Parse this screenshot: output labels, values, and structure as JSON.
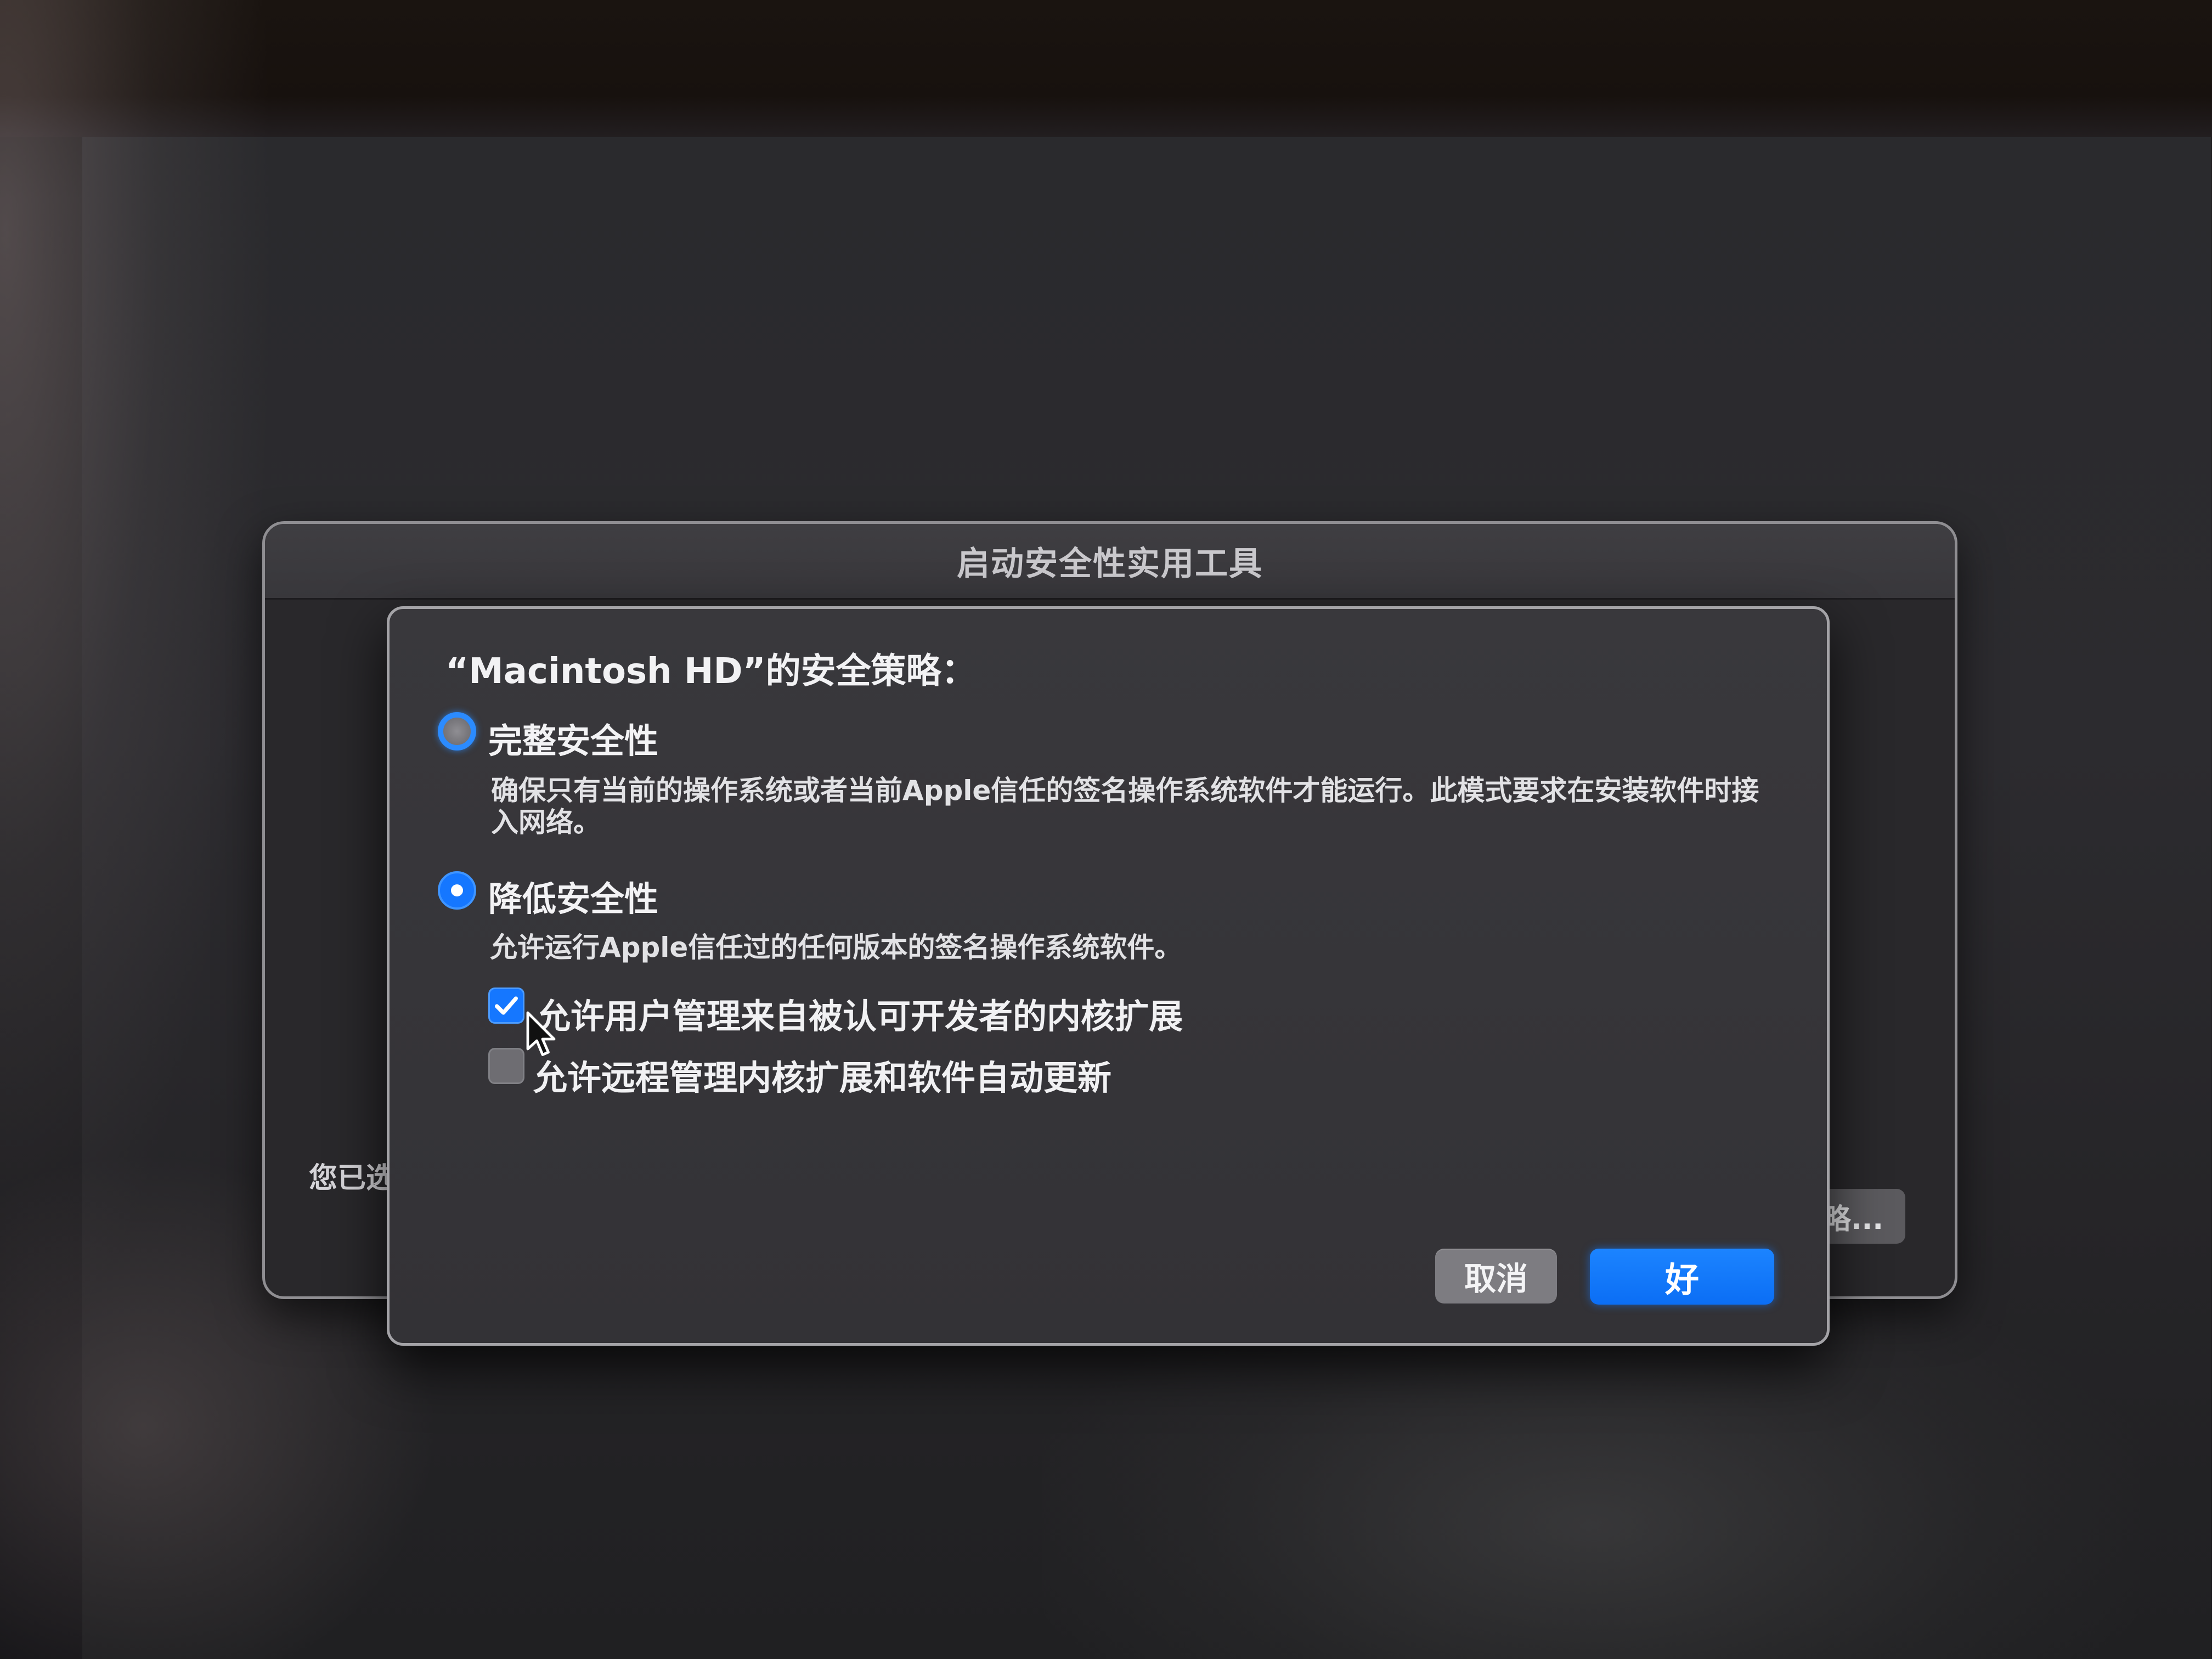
{
  "window": {
    "title": "启动安全性实用工具",
    "status_text": "您已选",
    "button_label": "略..."
  },
  "sheet": {
    "policy_title": "“Macintosh HD”的安全策略：",
    "options": [
      {
        "label": "完整安全性",
        "description": "确保只有当前的操作系统或者当前Apple信任的签名操作系统软件才能运行。此模式要求在安装软件时接入网络。",
        "selected": false
      },
      {
        "label": "降低安全性",
        "description": "允许运行Apple信任过的任何版本的签名操作系统软件。",
        "selected": true
      }
    ],
    "checkboxes": [
      {
        "label": "允许用户管理来自被认可开发者的内核扩展",
        "checked": true
      },
      {
        "label": "允许远程管理内核扩展和软件自动更新",
        "checked": false
      }
    ],
    "buttons": {
      "cancel": "取消",
      "ok": "好"
    }
  },
  "colors": {
    "accent": "#1577ff",
    "sheet_bg": "#363539",
    "window_bg": "#29282b",
    "text": "#ececee"
  },
  "icons": {
    "checkmark": "checkmark-icon",
    "cursor": "arrow-cursor-icon"
  }
}
